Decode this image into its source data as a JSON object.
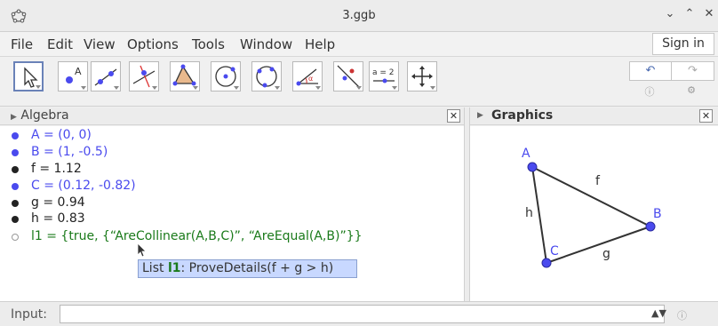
{
  "window": {
    "title": "3.ggb"
  },
  "menu": [
    "File",
    "Edit",
    "View",
    "Options",
    "Tools",
    "Window",
    "Help"
  ],
  "signin_label": "Sign in",
  "toolbar": {
    "tools": [
      "move-tool",
      "point-tool",
      "line-tool",
      "perpendicular-line-tool",
      "polygon-tool",
      "circle-tool",
      "circle-through-points-tool",
      "angle-tool",
      "reflect-tool",
      "slider-tool",
      "move-graphics-view-tool"
    ],
    "slider_icon_text": "a = 2"
  },
  "algebra": {
    "header": "Algebra",
    "rows": [
      {
        "text": "A = (0, 0)",
        "color": "#4a4aee",
        "dot": "filled"
      },
      {
        "text": "B = (1, -0.5)",
        "color": "#4a4aee",
        "dot": "filled"
      },
      {
        "text": "f = 1.12",
        "color": "#222222",
        "dot": "filled"
      },
      {
        "text": "C = (0.12, -0.82)",
        "color": "#4a4aee",
        "dot": "filled"
      },
      {
        "text": "g = 0.94",
        "color": "#222222",
        "dot": "filled"
      },
      {
        "text": "h = 0.83",
        "color": "#222222",
        "dot": "filled"
      },
      {
        "text": "l1 = {true, {“AreCollinear(A,B,C)”, “AreEqual(A,B)”}}",
        "color": "#1a7a1a",
        "dot": "hollow"
      }
    ],
    "tooltip": {
      "prefix": "List ",
      "name": "l1",
      "detail": ": ProveDetails(f + g > h)"
    }
  },
  "graphics": {
    "header": "Graphics",
    "point_labels": {
      "A": "A",
      "B": "B",
      "C": "C"
    },
    "segment_labels": {
      "f": "f",
      "g": "g",
      "h": "h"
    }
  },
  "input": {
    "label": "Input:",
    "value": ""
  },
  "colors": {
    "point": "#4a4aee",
    "accent": "#6a82b8",
    "tooltip_bg": "#c8d8ff"
  }
}
